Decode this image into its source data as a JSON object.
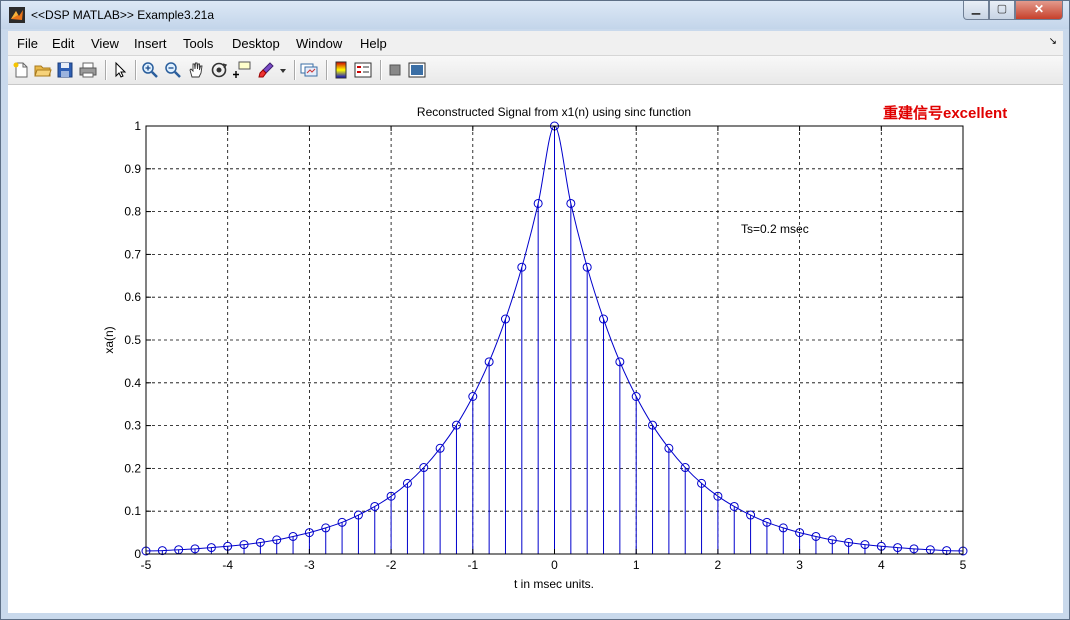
{
  "window": {
    "title": "<<DSP MATLAB>> Example3.21a"
  },
  "menu": [
    "File",
    "Edit",
    "View",
    "Insert",
    "Tools",
    "Desktop",
    "Window",
    "Help"
  ],
  "toolbar_icons": [
    "new-file-icon",
    "open-folder-icon",
    "save-icon",
    "print-icon",
    "pointer-icon",
    "zoom-in-icon",
    "zoom-out-icon",
    "pan-hand-icon",
    "rotate-3d-icon",
    "data-cursor-icon",
    "brush-icon",
    "dropdown-arrow-icon",
    "link-plot-icon",
    "colorbar-icon",
    "legend-icon",
    "hide-plot-tools-icon",
    "show-plot-tools-icon"
  ],
  "annotation": {
    "text": "重建信号excellent",
    "color": "#e00000"
  },
  "colors": {
    "series": "#0000cc",
    "grid": "#000000"
  },
  "chart_data": {
    "type": "line",
    "title": "Reconstructed Signal from x1(n) using sinc function",
    "xlabel": "t in msec units.",
    "ylabel": "xa(n)",
    "xlim": [
      -5,
      5
    ],
    "ylim": [
      0,
      1
    ],
    "xticks": [
      -5,
      -4,
      -3,
      -2,
      -1,
      0,
      1,
      2,
      3,
      4,
      5
    ],
    "yticks": [
      0,
      0.1,
      0.2,
      0.3,
      0.4,
      0.5,
      0.6,
      0.7,
      0.8,
      0.9,
      1
    ],
    "grid": true,
    "text_annotation": "Ts=0.2 msec",
    "samples_x": [
      -5.0,
      -4.8,
      -4.6,
      -4.4,
      -4.2,
      -4.0,
      -3.8,
      -3.6,
      -3.4,
      -3.2,
      -3.0,
      -2.8,
      -2.6,
      -2.4,
      -2.2,
      -2.0,
      -1.8,
      -1.6,
      -1.4,
      -1.2,
      -1.0,
      -0.8,
      -0.6,
      -0.4,
      -0.2,
      0.0,
      0.2,
      0.4,
      0.6,
      0.8,
      1.0,
      1.2,
      1.4,
      1.6,
      1.8,
      2.0,
      2.2,
      2.4,
      2.6,
      2.8,
      3.0,
      3.2,
      3.4,
      3.6,
      3.8,
      4.0,
      4.2,
      4.4,
      4.6,
      4.8,
      5.0
    ],
    "samples_y": [
      0.007,
      0.008,
      0.01,
      0.012,
      0.015,
      0.018,
      0.022,
      0.027,
      0.033,
      0.041,
      0.05,
      0.061,
      0.074,
      0.091,
      0.111,
      0.135,
      0.165,
      0.202,
      0.247,
      0.301,
      0.368,
      0.449,
      0.549,
      0.67,
      0.819,
      1.0,
      0.819,
      0.67,
      0.549,
      0.449,
      0.368,
      0.301,
      0.247,
      0.202,
      0.165,
      0.135,
      0.111,
      0.091,
      0.074,
      0.061,
      0.05,
      0.041,
      0.033,
      0.027,
      0.022,
      0.018,
      0.015,
      0.012,
      0.01,
      0.008,
      0.007
    ]
  }
}
